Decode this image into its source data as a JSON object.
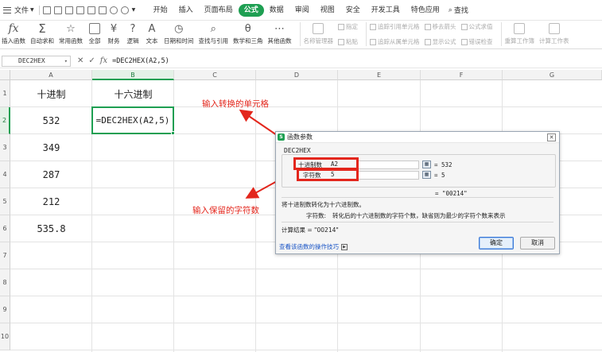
{
  "menubar": {
    "file_label": "文件",
    "tabs": [
      "开始",
      "插入",
      "页面布局",
      "公式",
      "数据",
      "审阅",
      "视图",
      "安全",
      "开发工具",
      "特色应用"
    ],
    "active_tab": "公式",
    "search_label": "查找"
  },
  "ribbon": {
    "insert_function": "插入函数",
    "autosum": "自动求和",
    "common": "常用函数",
    "all": "全部",
    "finance": "财务",
    "logic": "逻辑",
    "text": "文本",
    "datetime": "日期和时间",
    "lookup": "查找与引用",
    "math": "数学和三角",
    "other": "其他函数",
    "name_manager": "名称管理器",
    "define": "指定",
    "paste": "粘贴",
    "trace_precedents": "追踪引用单元格",
    "trace_dependents": "追踪从属单元格",
    "remove_arrows": "移去箭头",
    "show_formulas": "显示公式",
    "formula_eval": "公式求值",
    "error_check": "错误检查",
    "recalc_book": "重算工作簿",
    "calc_sheet": "计算工作表"
  },
  "formula_bar": {
    "name_box": "DEC2HEX",
    "formula": "=DEC2HEX(A2,5)"
  },
  "sheet": {
    "columns": [
      "A",
      "B",
      "C",
      "D",
      "E",
      "F",
      "G"
    ],
    "rows": [
      "1",
      "2",
      "3",
      "4",
      "5",
      "6",
      "7",
      "8",
      "9",
      "10"
    ],
    "a1": "十进制",
    "b1": "十六进制",
    "a_values": [
      "532",
      "349",
      "287",
      "212",
      "535.8"
    ],
    "b2": "=DEC2HEX(A2,5)"
  },
  "annotations": {
    "top": "输入转换的单元格",
    "bottom": "输入保留的字符数"
  },
  "dialog": {
    "title": "函数参数",
    "function_name": "DEC2HEX",
    "arg1_label": "十进制数",
    "arg1_value": "A2",
    "arg1_result": "= 532",
    "arg2_label": "字符数",
    "arg2_value": "5",
    "arg2_result": "= 5",
    "overall_result": "= \"00214\"",
    "description": "将十进制数转化为十六进制数。",
    "param_name": "字符数:",
    "param_desc": "转化后的十六进制数的字符个数，缺省则为最少的字符个数来表示",
    "calc_result": "计算结果 = \"00214\"",
    "help_link": "查看该函数的操作技巧",
    "ok": "确定",
    "cancel": "取消"
  },
  "colors": {
    "accent": "#1e9f52",
    "annotation": "#e3261c",
    "link": "#1a55c6"
  }
}
